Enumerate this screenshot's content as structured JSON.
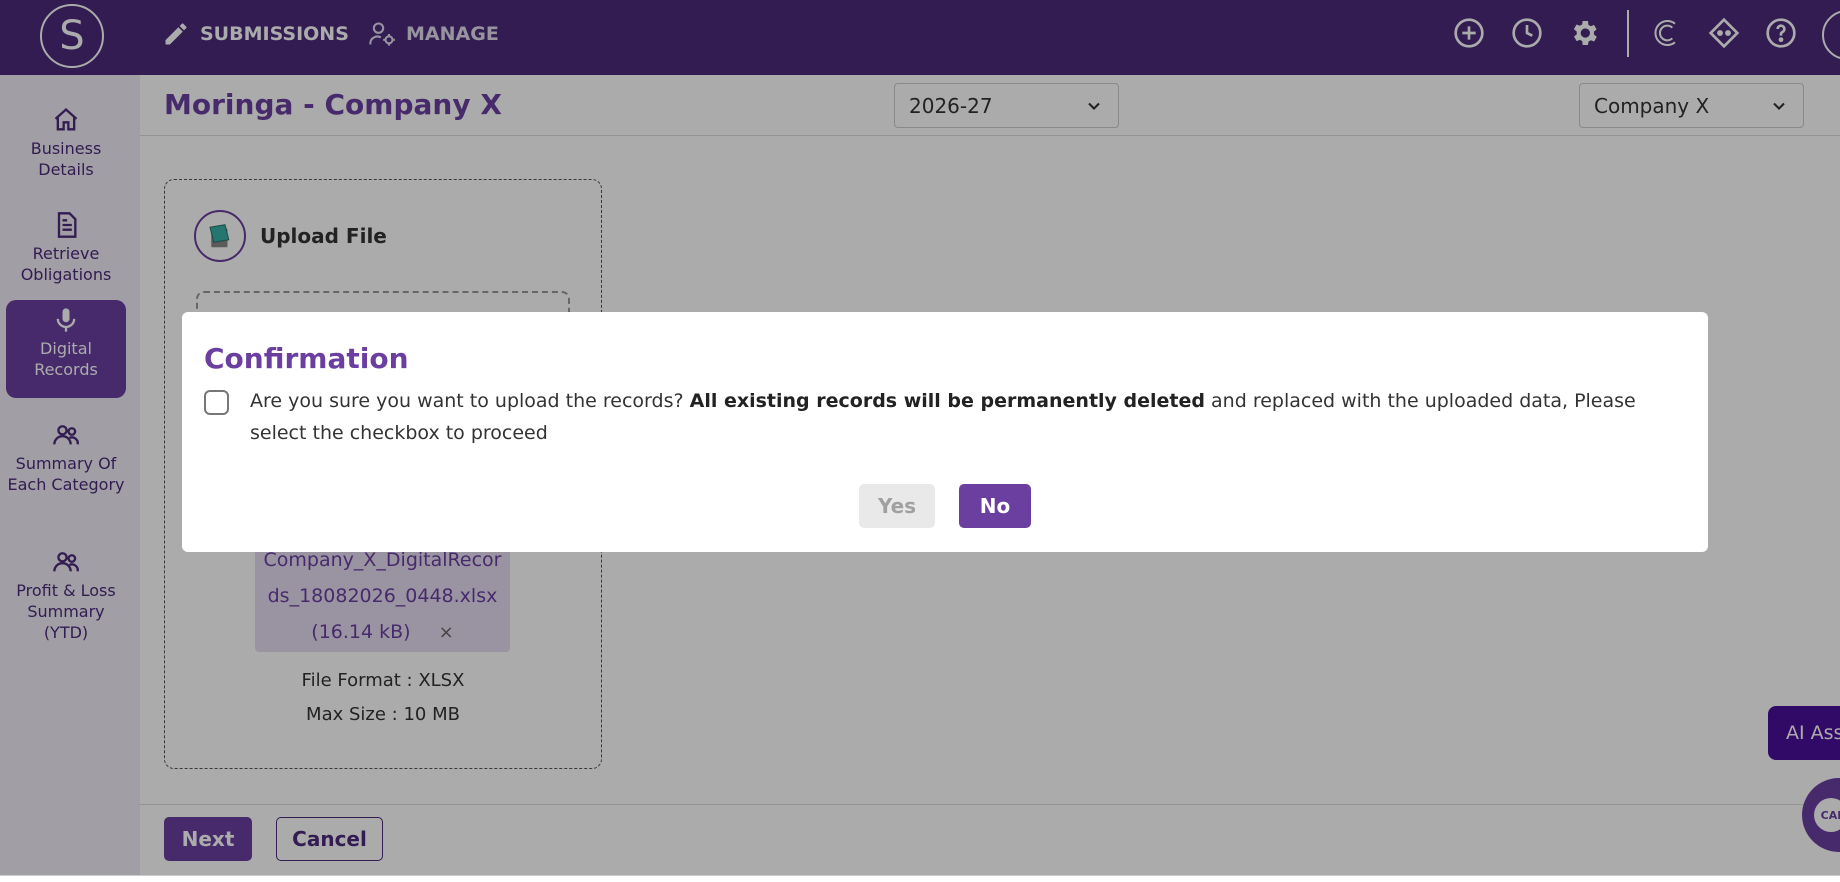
{
  "header": {
    "logo_letter": "S",
    "nav": [
      {
        "label": "SUBMISSIONS",
        "icon": "pencil-icon"
      },
      {
        "label": "MANAGE",
        "icon": "user-gear-icon"
      }
    ],
    "icons": [
      "plus-circle-icon",
      "clock-icon",
      "gear-icon",
      "c-logo-icon",
      "diamond-icon",
      "help-icon"
    ]
  },
  "sidebar": {
    "items": [
      {
        "label": "Business Details",
        "icon": "home-icon"
      },
      {
        "label": "Retrieve Obligations",
        "icon": "document-icon"
      },
      {
        "label": "Digital Records",
        "icon": "microphone-icon",
        "active": true
      },
      {
        "label": "Summary Of Each Category",
        "icon": "users-icon"
      },
      {
        "label": "Profit & Loss Summary (YTD)",
        "icon": "users-icon"
      }
    ]
  },
  "main": {
    "title": "Moringa - Company X",
    "year_select": "2026-27",
    "company_select": "Company X",
    "upload": {
      "heading": "Upload File",
      "file_name_line1": "Company_X_DigitalRecor",
      "file_name_line2": "ds_18082026_0448.xlsx",
      "file_size": "(16.14 kB)",
      "remove": "×",
      "format": "File Format : XLSX",
      "max_size": "Max Size : 10 MB"
    },
    "next_label": "Next",
    "cancel_label": "Cancel"
  },
  "ai_assistant_label": "AI Assi",
  "chat_label": "CAI",
  "modal": {
    "title": "Confirmation",
    "text_before": "Are you sure you want to upload the records? ",
    "text_bold": "All existing records will be permanently deleted",
    "text_after": " and replaced with the uploaded data, Please select the checkbox to proceed",
    "yes_label": "Yes",
    "no_label": "No"
  },
  "colors": {
    "brand": "#4b2a7a",
    "accent": "#6b3fa0",
    "ai_button": "#4a0e9a"
  }
}
